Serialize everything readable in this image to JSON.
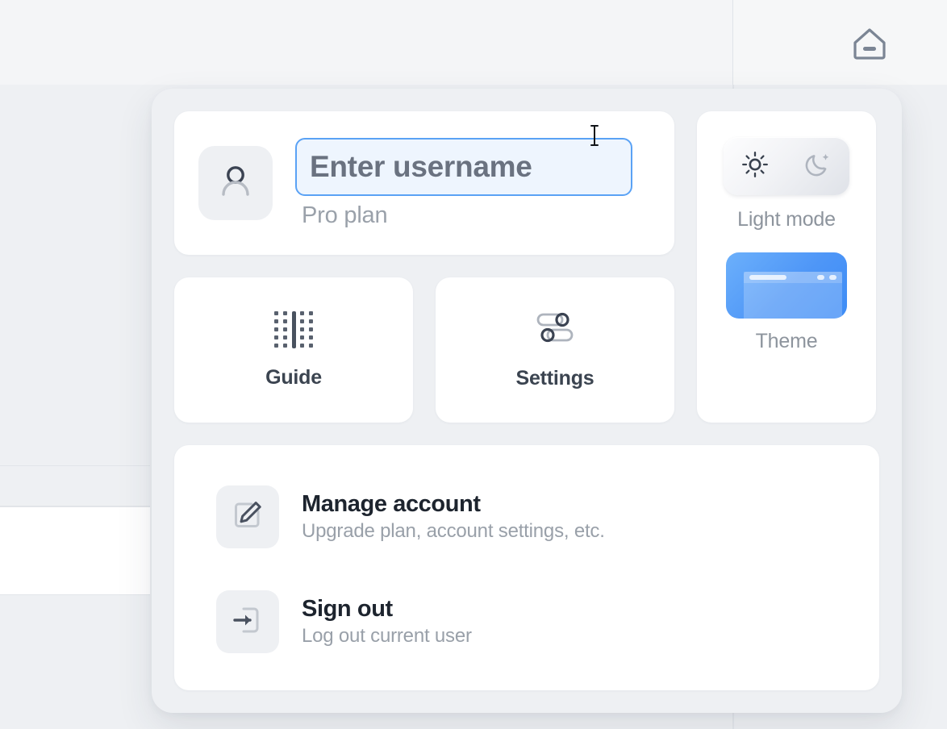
{
  "background": {
    "home_icon": "home-icon",
    "list_rows": [
      {
        "kind": "header-row"
      },
      {
        "kind": "content-row"
      }
    ]
  },
  "popover": {
    "identity": {
      "avatar_icon": "user-avatar-icon",
      "username_value": "",
      "username_placeholder": "Enter username",
      "plan_label": "Pro plan"
    },
    "quick_actions": [
      {
        "label": "Guide",
        "icon": "guide-dots-icon"
      },
      {
        "label": "Settings",
        "icon": "sliders-icon"
      }
    ],
    "appearance": {
      "mode_toggle": {
        "light_icon": "sun-icon",
        "dark_icon": "moon-icon",
        "active": "light"
      },
      "mode_caption": "Light mode",
      "theme_thumbnail_icon": "theme-preview-icon",
      "theme_caption": "Theme"
    },
    "account_items": [
      {
        "icon": "edit-square-icon",
        "title": "Manage account",
        "subtitle": "Upgrade plan, account settings, etc."
      },
      {
        "icon": "sign-out-icon",
        "title": "Sign out",
        "subtitle": "Log out current user"
      }
    ]
  },
  "colors": {
    "accent": "#4e96f7",
    "focus_border": "#5aa2f5",
    "focus_fill": "#eef5fe",
    "surface": "#ffffff",
    "panel": "#eef0f3",
    "page": "#f4f5f7",
    "text_primary": "#1d242e",
    "text_muted": "#99a0a9"
  }
}
